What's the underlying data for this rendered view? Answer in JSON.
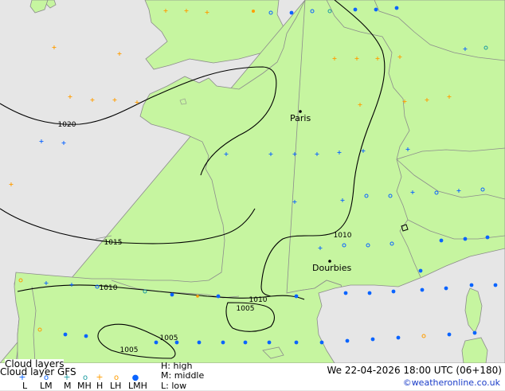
{
  "map": {
    "colors": {
      "sea": "#e6e6e6",
      "land": "#c6f5a0",
      "border": "#8c8c8c",
      "isobar": "#000000"
    },
    "cities": [
      {
        "name": "Paris"
      },
      {
        "name": "Dourbies"
      }
    ],
    "isobar_labels": [
      "1020",
      "1015",
      "1010",
      "1010",
      "1010",
      "1005",
      "1005",
      "1005"
    ],
    "marker_symbols": {
      "high": "+",
      "middle": "o",
      "low": "●"
    },
    "marker_colors": {
      "orange": "#ff9d00",
      "blue": "#0a64ff",
      "teal": "#1a9aa0"
    }
  },
  "footer": {
    "layers_title": "Cloud layers",
    "model_label": "Cloud layer GFS",
    "symbol_row": [
      "+",
      "o",
      "+",
      "o",
      "+",
      "o",
      "●"
    ],
    "codes": [
      "L",
      "LM",
      "M",
      "MH",
      "H",
      "LH",
      "LMH"
    ],
    "legend_h": "H: high",
    "legend_m": "M: middle",
    "legend_l": "L: low",
    "datetime": "We 22-04-2026 18:00 UTC (06+180)",
    "credit": "©weatheronline.co.uk"
  }
}
